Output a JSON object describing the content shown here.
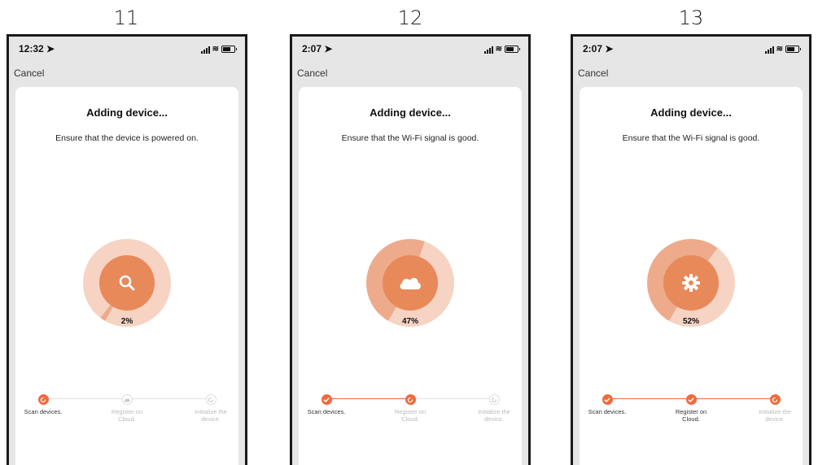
{
  "panels": [
    {
      "step": "11",
      "time": "12:32",
      "cancel": "Cancel",
      "title": "Adding device...",
      "subtitle": "Ensure that the device is powered on.",
      "percent": "2%",
      "progress": 0.02,
      "icon": "search-icon",
      "steps": [
        {
          "label": "Scan devices.",
          "state": "active"
        },
        {
          "label": "Register on Cloud.",
          "state": "pending"
        },
        {
          "label": "Initialize the device.",
          "state": "pending"
        }
      ]
    },
    {
      "step": "12",
      "time": "2:07",
      "cancel": "Cancel",
      "title": "Adding device...",
      "subtitle": "Ensure that the Wi-Fi signal is good.",
      "percent": "47%",
      "progress": 0.47,
      "icon": "cloud-icon",
      "steps": [
        {
          "label": "Scan devices.",
          "state": "done"
        },
        {
          "label": "Register on Cloud.",
          "state": "active"
        },
        {
          "label": "Initialize the device.",
          "state": "pending"
        }
      ]
    },
    {
      "step": "13",
      "time": "2:07",
      "cancel": "Cancel",
      "title": "Adding device...",
      "subtitle": "Ensure that the Wi-Fi signal is good.",
      "percent": "52%",
      "progress": 0.52,
      "icon": "gear-icon",
      "steps": [
        {
          "label": "Scan devices.",
          "state": "done"
        },
        {
          "label": "Register on Cloud.",
          "state": "done"
        },
        {
          "label": "Initialize the device.",
          "state": "active"
        }
      ]
    }
  ],
  "colors": {
    "accent": "#f06a3c",
    "ring_light": "#f6d3c3",
    "ring_mid": "#edab8b",
    "inner": "#e8895a"
  }
}
